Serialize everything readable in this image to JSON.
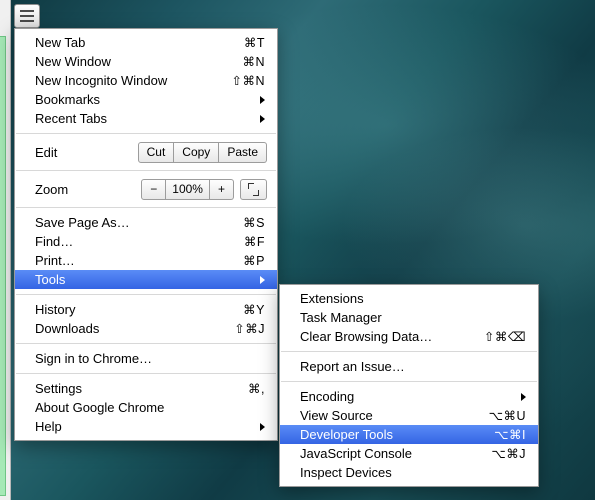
{
  "hamburger": {
    "name": "menu-button"
  },
  "main_menu": {
    "new_tab": {
      "label": "New Tab",
      "shortcut": "⌘T"
    },
    "new_window": {
      "label": "New Window",
      "shortcut": "⌘N"
    },
    "new_incognito": {
      "label": "New Incognito Window",
      "shortcut": "⇧⌘N"
    },
    "bookmarks": {
      "label": "Bookmarks"
    },
    "recent_tabs": {
      "label": "Recent Tabs"
    },
    "edit": {
      "label": "Edit",
      "cut": "Cut",
      "copy": "Copy",
      "paste": "Paste"
    },
    "zoom": {
      "label": "Zoom",
      "minus": "−",
      "value": "100%",
      "plus": "+"
    },
    "save_as": {
      "label": "Save Page As…",
      "shortcut": "⌘S"
    },
    "find": {
      "label": "Find…",
      "shortcut": "⌘F"
    },
    "print": {
      "label": "Print…",
      "shortcut": "⌘P"
    },
    "tools": {
      "label": "Tools"
    },
    "history": {
      "label": "History",
      "shortcut": "⌘Y"
    },
    "downloads": {
      "label": "Downloads",
      "shortcut": "⇧⌘J"
    },
    "signin": {
      "label": "Sign in to Chrome…"
    },
    "settings": {
      "label": "Settings",
      "shortcut": "⌘,"
    },
    "about": {
      "label": "About Google Chrome"
    },
    "help": {
      "label": "Help"
    }
  },
  "sub_menu": {
    "extensions": {
      "label": "Extensions"
    },
    "task_manager": {
      "label": "Task Manager"
    },
    "clear_data": {
      "label": "Clear Browsing Data…",
      "shortcut": "⇧⌘⌫"
    },
    "report_issue": {
      "label": "Report an Issue…"
    },
    "encoding": {
      "label": "Encoding"
    },
    "view_source": {
      "label": "View Source",
      "shortcut": "⌥⌘U"
    },
    "dev_tools": {
      "label": "Developer Tools",
      "shortcut": "⌥⌘I"
    },
    "js_console": {
      "label": "JavaScript Console",
      "shortcut": "⌥⌘J"
    },
    "inspect_dev": {
      "label": "Inspect Devices"
    }
  }
}
